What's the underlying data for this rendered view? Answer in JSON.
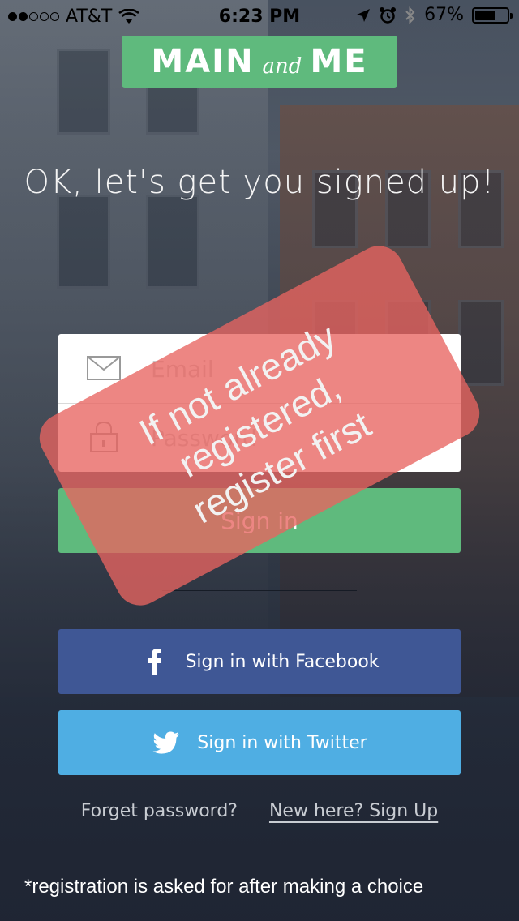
{
  "status_bar": {
    "carrier": "AT&T",
    "time": "6:23 PM",
    "battery": "67%",
    "battery_level": 0.67,
    "signal_bars": 2
  },
  "logo": {
    "part1": "MAIN",
    "part2": "and",
    "part3": "ME"
  },
  "headline": "OK, let's get you signed up!",
  "form": {
    "email_placeholder": "Email",
    "password_placeholder": "Password",
    "signin_label": "Sign in"
  },
  "social": {
    "facebook_label": "Sign in with Facebook",
    "twitter_label": "Sign in with Twitter"
  },
  "links": {
    "forgot": "Forget password?",
    "signup": "New here? Sign Up"
  },
  "overlay": {
    "line1": "If not already",
    "line2": "registered,",
    "line3": "register first"
  },
  "footnote": "*registration is asked for after making a choice",
  "colors": {
    "brand_green": "#5fba7d",
    "facebook": "#3f5795",
    "twitter": "#4faee3",
    "overlay_red": "#e86460"
  }
}
